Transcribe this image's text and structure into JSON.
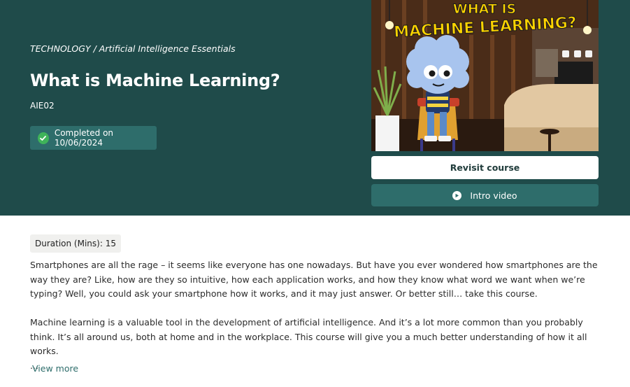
{
  "course": {
    "breadcrumb": "TECHNOLOGY / Artificial Intelligence Essentials",
    "title": "What is Machine Learning?",
    "code": "AIE02",
    "completed_label": "Completed on 10/06/2024"
  },
  "thumbnail": {
    "title_line1": "WHAT IS",
    "title_line2": "MACHINE LEARNING?",
    "title_color": "#ffd400"
  },
  "actions": {
    "revisit_label": "Revisit course",
    "intro_label": "Intro video"
  },
  "details": {
    "duration": "Duration (Mins): 15",
    "paragraphs": [
      "Smartphones are all the rage – it seems like everyone has one nowadays. But have you ever wondered how smartphones are the way they are? Like, how are they so intuitive, how each application works, and how they know what word we want when we’re typing? Well, you could ask your smartphone how it works, and it may just answer. Or better still… take this course.",
      "Machine learning is a valuable tool in the development of artificial intelligence. And it’s a lot more common than you probably think. It’s all around us, both at home and in the workplace. This course will give you a much better understanding of how it all works."
    ],
    "ellipsis": "...",
    "view_more": "View more"
  },
  "colors": {
    "hero_bg": "#1f4b4a",
    "accent": "#2e6d6b",
    "success": "#3fb35a"
  }
}
